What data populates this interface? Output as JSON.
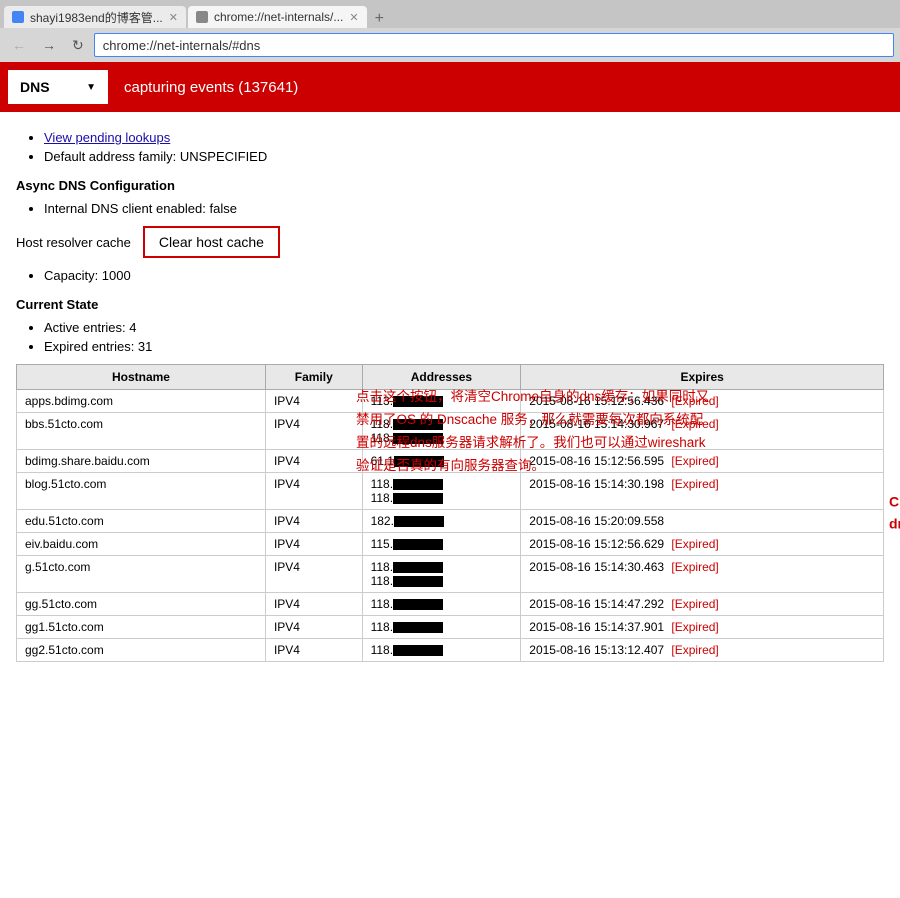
{
  "browser": {
    "tabs": [
      {
        "id": "tab1",
        "label": "shayi1983end的博客管...",
        "active": false
      },
      {
        "id": "tab2",
        "label": "chrome://net-internals/...",
        "active": true
      }
    ],
    "address": "chrome://net-internals/#dns"
  },
  "header": {
    "dropdown_label": "DNS",
    "dropdown_arrow": "▼",
    "title": "capturing events (137641)"
  },
  "content": {
    "link_pending": "View pending lookups",
    "default_family": "Default address family: UNSPECIFIED",
    "async_heading": "Async DNS Configuration",
    "internal_dns": "Internal DNS client enabled: false",
    "host_resolver_label": "Host resolver cache",
    "clear_cache_btn": "Clear host cache",
    "capacity": "Capacity: 1000",
    "current_state_heading": "Current State",
    "active_entries": "Active entries: 4",
    "expired_entries": "Expired entries: 31"
  },
  "annotation": {
    "text": "点击这个按钮，将清空Chrome自身的dns缓存；如果同时又禁用了OS 的 Dnscache 服务，那么就需要每次都向系统配置的远程dns服务器请求解析了。我们也可以通过wireshark验证是否真的有向服务器查询。"
  },
  "table": {
    "headers": [
      "Hostname",
      "Family",
      "Addresses",
      "Expires"
    ],
    "rows": [
      {
        "hostname": "apps.bdimg.com",
        "family": "IPV4",
        "addresses": "113.■■■■■",
        "expires": "2015-08-16 15:12:56.436",
        "expired": true
      },
      {
        "hostname": "bbs.51cto.com",
        "family": "IPV4",
        "addresses": "118.■\n118.■",
        "expires": "2015-08-16 15:14:30.967",
        "expired": true
      },
      {
        "hostname": "bdimg.share.baidu.com",
        "family": "IPV4",
        "addresses": "61.1■",
        "expires": "2015-08-16 15:12:56.595",
        "expired": true
      },
      {
        "hostname": "blog.51cto.com",
        "family": "IPV4",
        "addresses": "118.■\n118.■",
        "expires": "2015-08-16 15:14:30.198",
        "expired": true
      },
      {
        "hostname": "edu.51cto.com",
        "family": "IPV4",
        "addresses": "182.■",
        "expires": "2015-08-16 15:20:09.558",
        "expired": false
      },
      {
        "hostname": "eiv.baidu.com",
        "family": "IPV4",
        "addresses": "115.■",
        "expires": "2015-08-16 15:12:56.629",
        "expired": true
      },
      {
        "hostname": "g.51cto.com",
        "family": "IPV4",
        "addresses": "118.■\n118.■",
        "expires": "2015-08-16 15:14:30.463",
        "expired": true
      },
      {
        "hostname": "gg.51cto.com",
        "family": "IPV4",
        "addresses": "118.■",
        "expires": "2015-08-16 15:14:47.292",
        "expired": true
      },
      {
        "hostname": "gg1.51cto.com",
        "family": "IPV4",
        "addresses": "118.■",
        "expires": "2015-08-16 15:14:37.901",
        "expired": true
      },
      {
        "hostname": "gg2.51cto.com",
        "family": "IPV4",
        "addresses": "118.■",
        "expires": "2015-08-16 15:13:12.407",
        "expired": true
      }
    ],
    "expired_label": "[Expired]",
    "table_annotation": "Chrome的\ndns缓存表"
  }
}
